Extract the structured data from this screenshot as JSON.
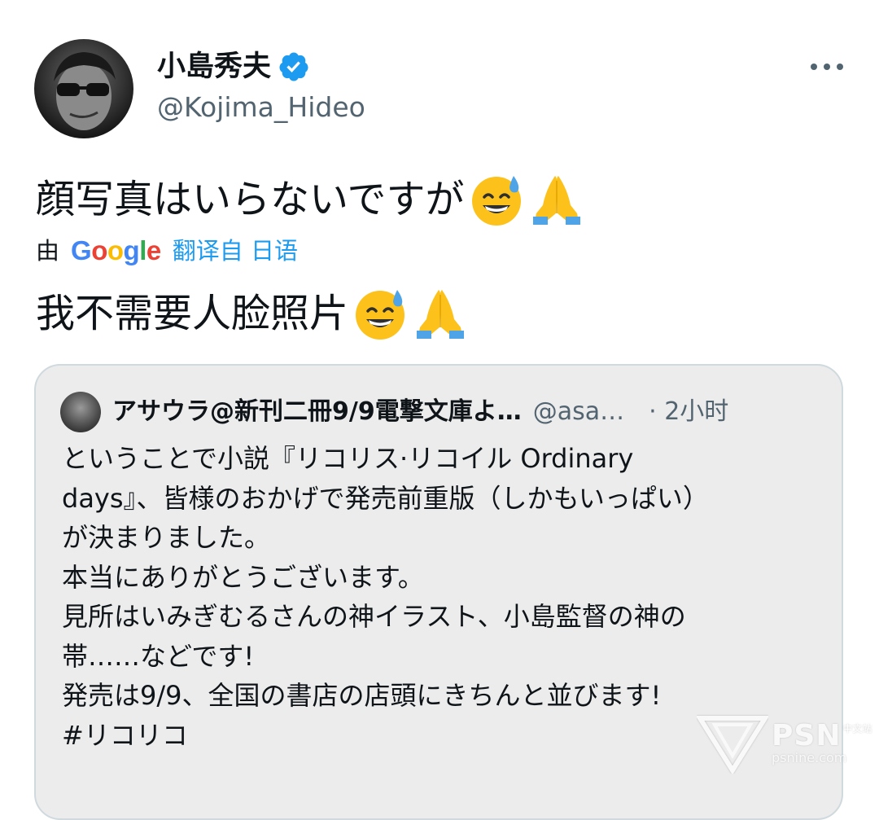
{
  "user": {
    "display_name": "小島秀夫",
    "handle": "@Kojima_Hideo",
    "verified": true,
    "verified_color": "#1d9bf0"
  },
  "tweet": {
    "text": "顔写真はいらないですが",
    "emojis": [
      "sweat-smile-emoji",
      "folded-hands-emoji"
    ],
    "translation_by": "由",
    "translation_provider": "Google",
    "translation_link": "翻译自 日语",
    "translated_text": "我不需要人脸照片"
  },
  "quoted_tweet": {
    "display_name": "アサウラ@新刊二冊9/9電撃文庫よ…",
    "handle": "@asa…",
    "time": "· 2小时",
    "lines": [
      "ということで小説『リコリス·リコイル Ordinary",
      "days』、皆様のおかげで発売前重版（しかもいっぱい）",
      "が決まりました。",
      "本当にありがとうございます。",
      "見所はいみぎむるさんの神イラスト、小島監督の神の",
      "帯……などです!",
      "発売は9/9、全国の書店の店頭にきちんと並びます!",
      "#リコリコ"
    ]
  },
  "watermark": {
    "brand": "PSN",
    "brand_cn": "中文站",
    "url": "psnine.com"
  },
  "colors": {
    "text": "#0f1419",
    "secondary": "#536471",
    "link": "#1d9bf0",
    "card_bg": "#ececec",
    "card_border": "#cfd9de"
  }
}
